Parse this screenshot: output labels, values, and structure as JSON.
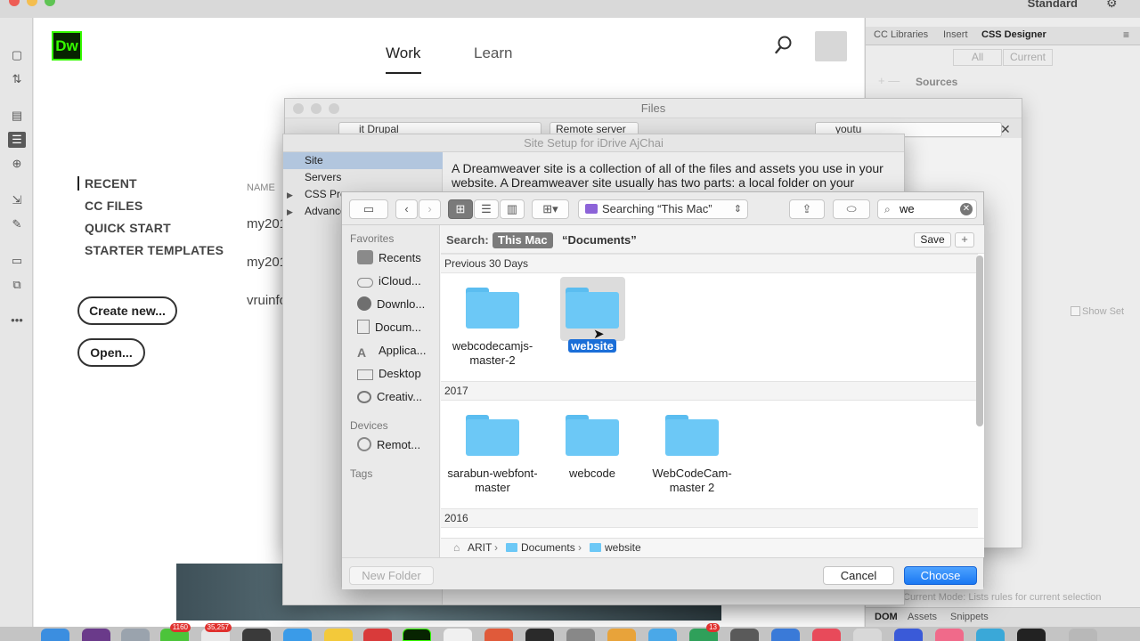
{
  "app": {
    "workspace": "Standard",
    "logo_text": "Dw"
  },
  "start_screen": {
    "nav": {
      "work": "Work",
      "learn": "Learn"
    },
    "sidebar": [
      "RECENT",
      "CC FILES",
      "QUICK START",
      "STARTER TEMPLATES"
    ],
    "column_name": "NAME",
    "recent_files": [
      "my201",
      "my201",
      "vruinfo"
    ],
    "buttons": {
      "create_new": "Create new...",
      "open": "Open..."
    }
  },
  "right_panel": {
    "tabs": [
      "CC Libraries",
      "Insert",
      "CSS Designer"
    ],
    "filter": {
      "all": "All",
      "current": "Current"
    },
    "sources_label": "Sources",
    "show_set": "Show Set",
    "hint": "Current Mode: Lists rules for current selection",
    "bottom_tabs": [
      "DOM",
      "Assets",
      "Snippets"
    ]
  },
  "files_window": {
    "title": "Files",
    "site_select": "it Drupal",
    "server_select": "Remote server",
    "search_value": "youtu"
  },
  "site_setup": {
    "title": "Site Setup for iDrive AjChai",
    "sidebar": [
      "Site",
      "Servers",
      "CSS Preprocessors",
      "Advanced Settings"
    ],
    "description": "A Dreamweaver site is a collection of all of the files and assets you use in your website. A Dreamweaver site usually has two parts: a local folder on your"
  },
  "open_sheet": {
    "location": "Searching “This Mac”",
    "search_value": "we",
    "sidebar": {
      "favorites_head": "Favorites",
      "favorites": [
        "Recents",
        "iCloud...",
        "Downlo...",
        "Docum...",
        "Applica...",
        "Desktop",
        "Creativ..."
      ],
      "devices_head": "Devices",
      "devices": [
        "Remot..."
      ],
      "tags_head": "Tags"
    },
    "search_bar": {
      "label": "Search:",
      "this_mac": "This Mac",
      "documents": "“Documents”",
      "save": "Save",
      "plus": "+"
    },
    "groups": [
      {
        "title": "Previous 30 Days",
        "items": [
          "webcodecamjs-master-2",
          "website"
        ]
      },
      {
        "title": "2017",
        "items": [
          "sarabun-webfont-master",
          "webcode",
          "WebCodeCam-master 2"
        ]
      },
      {
        "title": "2016",
        "items": []
      }
    ],
    "selected_item": "website",
    "path": [
      "ARIT",
      "Documents",
      "website"
    ],
    "footer": {
      "new_folder": "New Folder",
      "cancel": "Cancel",
      "choose": "Choose"
    }
  },
  "dock": {
    "badges": [
      "1160",
      "35,257",
      "13"
    ]
  },
  "colors": {
    "accent": "#1a78f2",
    "folder": "#6cc8f6",
    "dw_green": "#35fa00"
  }
}
